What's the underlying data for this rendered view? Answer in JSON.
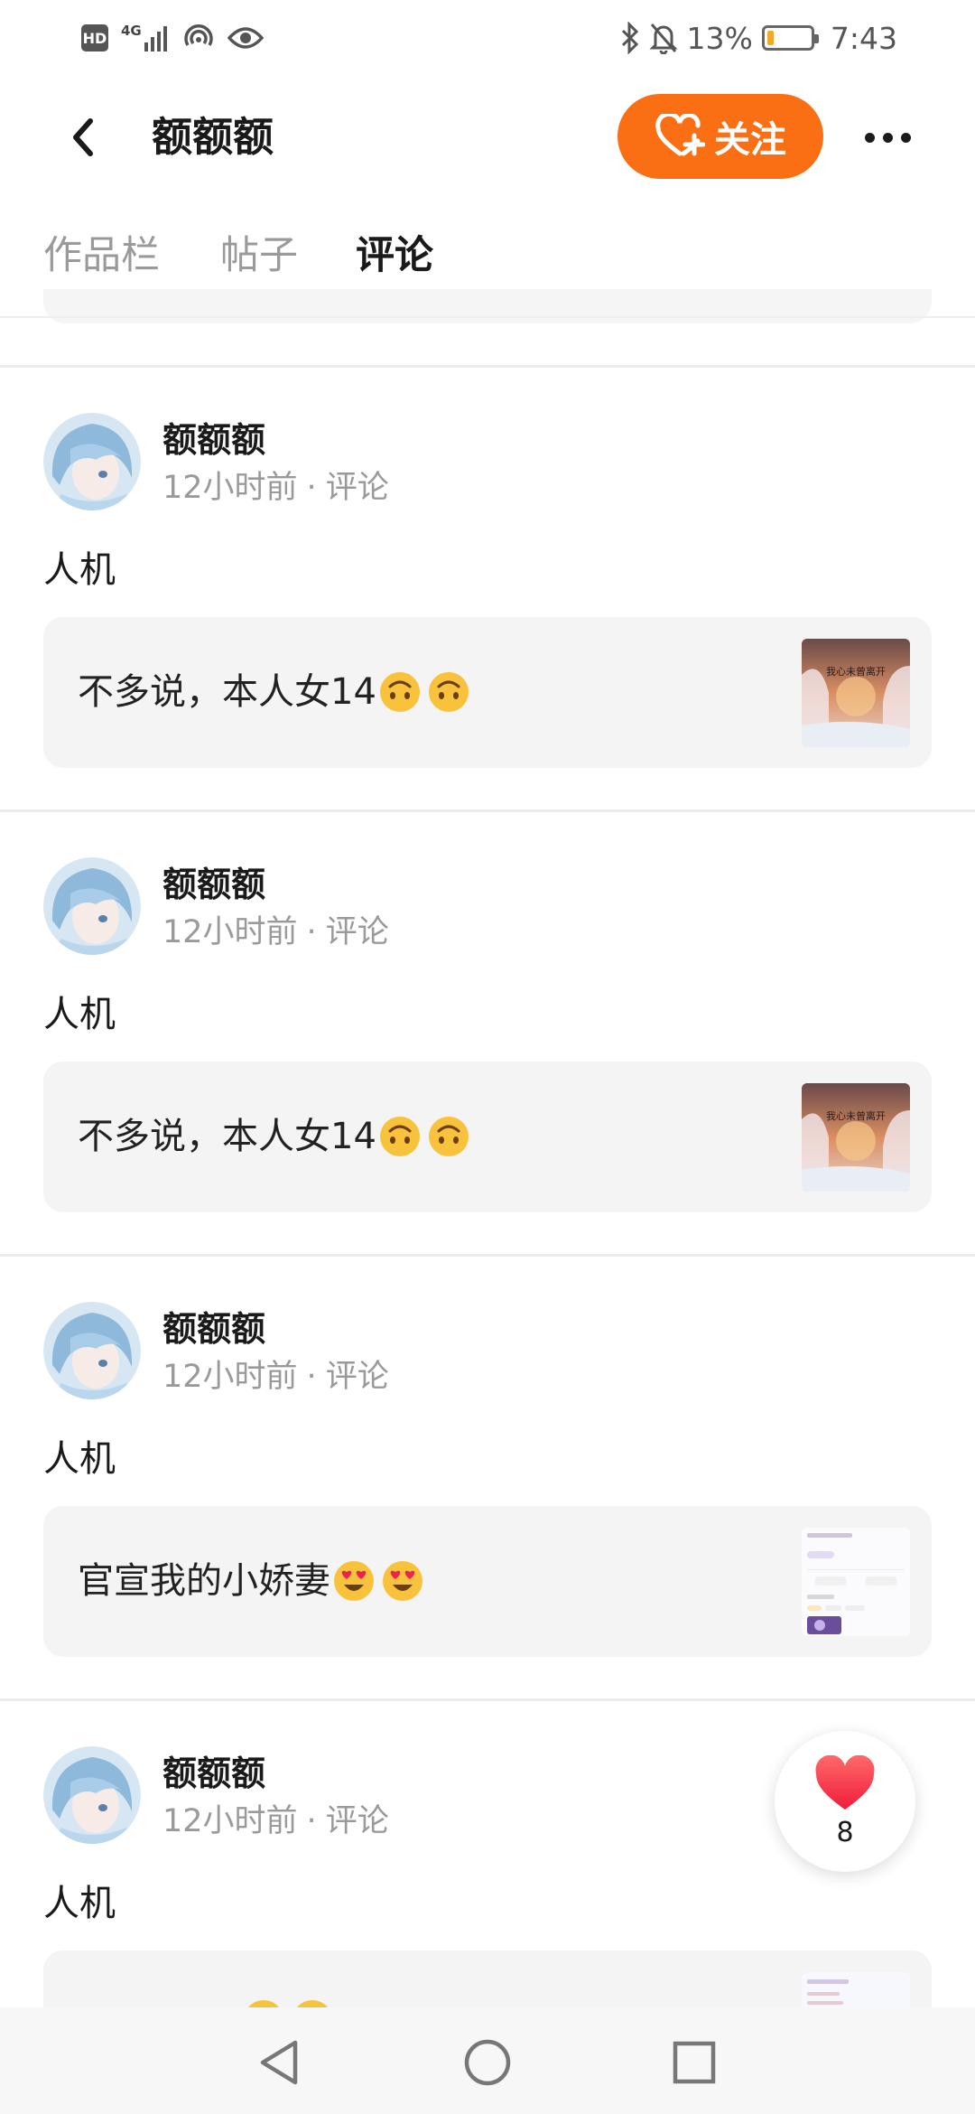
{
  "status_bar": {
    "hd_label": "HD",
    "network_label": "4G",
    "battery_percent": "13%",
    "battery_level": 0.13,
    "time": "7:43"
  },
  "header": {
    "back_icon": "chevron-left-icon",
    "title": "额额额",
    "follow_label": "关注",
    "follow_icon": "heart-plus-icon",
    "more_icon": "more-dots-icon"
  },
  "tabs": [
    {
      "label": "作品栏",
      "active": false
    },
    {
      "label": "帖子",
      "active": false
    },
    {
      "label": "评论",
      "active": true
    }
  ],
  "colors": {
    "accent": "#fa6e14",
    "text_primary": "#1a1a1a",
    "text_secondary": "#9a9a9a",
    "quote_bg": "#f4f4f4"
  },
  "posts": [
    {
      "author": "额额额",
      "time": "12小时前",
      "separator": "·",
      "type": "评论",
      "text": "人机",
      "quote_text": "不多说，本人女14",
      "quote_emoji": "upside-down-face",
      "thumb_caption": "我心未曾离开"
    },
    {
      "author": "额额额",
      "time": "12小时前",
      "separator": "·",
      "type": "评论",
      "text": "人机",
      "quote_text": "不多说，本人女14",
      "quote_emoji": "upside-down-face",
      "thumb_caption": "我心未曾离开"
    },
    {
      "author": "额额额",
      "time": "12小时前",
      "separator": "·",
      "type": "评论",
      "text": "人机",
      "quote_text": "官宣我的小娇妻",
      "quote_emoji": "heart-eyes"
    },
    {
      "author": "额额额",
      "time": "12小时前",
      "separator": "·",
      "type": "评论",
      "text": "人机",
      "quote_text": "",
      "quote_emoji": "heart-eyes"
    }
  ],
  "like_button": {
    "icon": "heart-icon",
    "count": "8"
  },
  "nav_bar": {
    "back_icon": "triangle-back-icon",
    "home_icon": "circle-home-icon",
    "recents_icon": "square-recents-icon"
  }
}
